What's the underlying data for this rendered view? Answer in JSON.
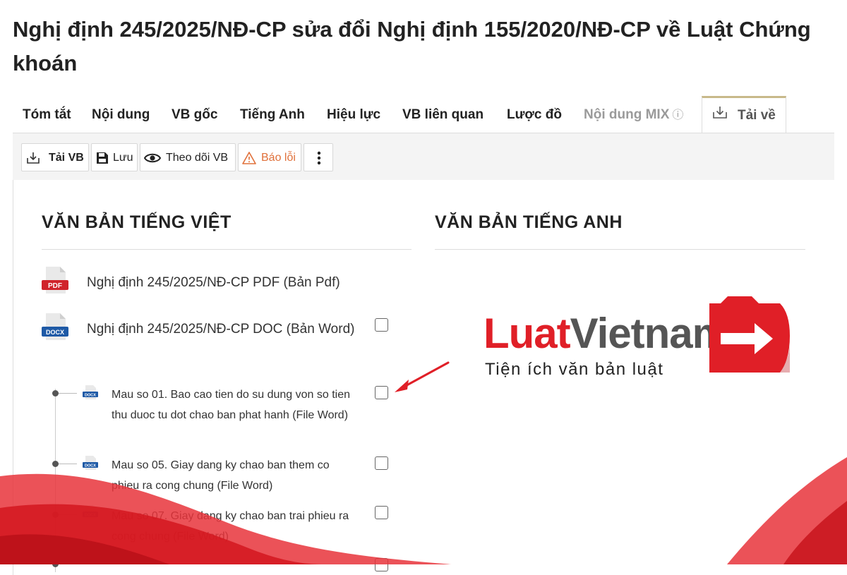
{
  "page_title": "Nghị định 245/2025/NĐ-CP sửa đổi Nghị định 155/2020/NĐ-CP về Luật Chứng khoán",
  "tabs": [
    {
      "label": "Tóm tắt"
    },
    {
      "label": "Nội dung"
    },
    {
      "label": "VB gốc"
    },
    {
      "label": "Tiếng Anh"
    },
    {
      "label": "Hiệu lực"
    },
    {
      "label": "VB liên quan"
    },
    {
      "label": "Lược đồ"
    },
    {
      "label": "Nội dung MIX",
      "icon": "info-icon"
    },
    {
      "label": "Tải về",
      "icon": "download-icon",
      "active": true
    }
  ],
  "toolbar": {
    "download": "Tải VB",
    "save": "Lưu",
    "follow": "Theo dõi VB",
    "report": "Báo lỗi",
    "more_icon": "more-vertical-icon"
  },
  "left_column": {
    "title": "VĂN BẢN TIẾNG VIỆT",
    "files": [
      {
        "label": "Nghị định 245/2025/NĐ-CP PDF (Bản Pdf)",
        "icon": "pdf-file-icon",
        "badge": "PDF"
      },
      {
        "label": "Nghị định 245/2025/NĐ-CP DOC (Bản Word)",
        "icon": "docx-file-icon",
        "badge": "DOCX",
        "checked": false
      }
    ],
    "attachments": [
      {
        "label": "Mau so 01. Bao cao tien do su dung von so tien thu duoc tu dot chao ban phat hanh (File Word)",
        "checked": false
      },
      {
        "label": "Mau so 05. Giay dang ky chao ban them co phieu ra cong chung (File Word)",
        "checked": false
      },
      {
        "label": "Mau so 07. Giay dang ky chao ban trai phieu ra cong chung (File Word)",
        "checked": false
      }
    ]
  },
  "right_column": {
    "title": "VĂN BẢN TIẾNG ANH"
  },
  "watermark": {
    "brand_red": "Luat",
    "brand_gray": "Vietnam",
    "tagline": "Tiện ích văn bản luật"
  },
  "colors": {
    "accent_red": "#e01f27",
    "warning_orange": "#e0703a",
    "active_tab_border": "#c8b98a",
    "wave_red": "#e8343b"
  }
}
